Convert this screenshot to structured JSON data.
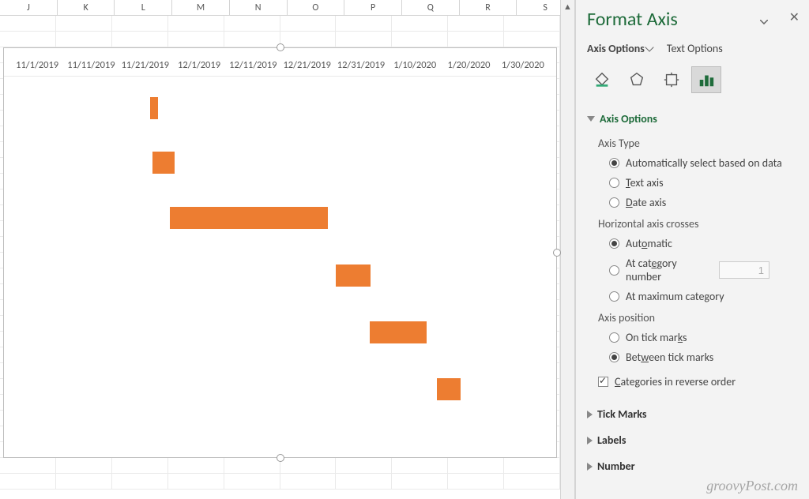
{
  "columns": [
    "J",
    "K",
    "L",
    "M",
    "N",
    "O",
    "P",
    "Q",
    "R",
    "S"
  ],
  "panel": {
    "title": "Format Axis",
    "tabs": {
      "axis": "Axis Options",
      "text": "Text Options"
    },
    "sections": {
      "axis_options": "Axis Options",
      "tick_marks": "Tick Marks",
      "labels": "Labels",
      "number": "Number"
    },
    "axis_type_label": "Axis Type",
    "axis_type": {
      "auto": "Automatically select based on data",
      "text": "Text axis",
      "date": "Date axis"
    },
    "crosses_label": "Horizontal axis crosses",
    "crosses": {
      "auto": "Automatic",
      "at_cat": "At category number",
      "at_cat_value": "1",
      "at_max": "At maximum category"
    },
    "position_label": "Axis position",
    "position": {
      "on": "On tick marks",
      "between": "Between tick marks"
    },
    "reverse": "Categories in reverse order"
  },
  "chart_data": {
    "type": "bar",
    "title": "",
    "xlabel": "",
    "ylabel": "",
    "x_axis_dates": [
      "11/1/2019",
      "11/11/2019",
      "11/21/2019",
      "12/1/2019",
      "12/11/2019",
      "12/21/2019",
      "12/31/2019",
      "1/10/2020",
      "1/20/2020",
      "1/30/2020"
    ],
    "series": [
      {
        "start": "11/22/2019",
        "end": "11/24/2019"
      },
      {
        "start": "11/23/2019",
        "end": "11/28/2019"
      },
      {
        "start": "12/1/2019",
        "end": "12/29/2019"
      },
      {
        "start": "12/29/2019",
        "end": "1/4/2020"
      },
      {
        "start": "1/4/2020",
        "end": "1/14/2020"
      },
      {
        "start": "1/16/2020",
        "end": "1/20/2020"
      }
    ]
  },
  "watermark": "groovyPost.com"
}
